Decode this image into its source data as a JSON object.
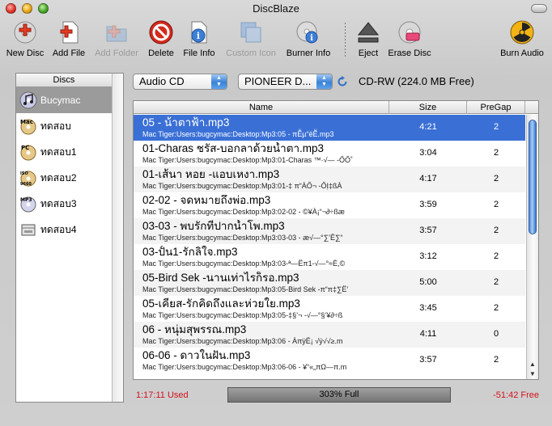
{
  "window": {
    "title": "DiscBlaze"
  },
  "toolbar": [
    {
      "label": "New Disc",
      "icon": "new-disc-icon",
      "enabled": true
    },
    {
      "label": "Add File",
      "icon": "add-file-icon",
      "enabled": true
    },
    {
      "label": "Add Folder",
      "icon": "add-folder-icon",
      "enabled": false
    },
    {
      "label": "Delete",
      "icon": "delete-icon",
      "enabled": true
    },
    {
      "label": "File Info",
      "icon": "file-info-icon",
      "enabled": true
    },
    {
      "label": "Custom Icon",
      "icon": "custom-icon-icon",
      "enabled": false
    },
    {
      "label": "Burner Info",
      "icon": "burner-info-icon",
      "enabled": true
    },
    {
      "label": "Eject",
      "icon": "eject-icon",
      "enabled": true
    },
    {
      "label": "Erase Disc",
      "icon": "erase-disc-icon",
      "enabled": true
    },
    {
      "label": "Burn Audio",
      "icon": "burn-audio-icon",
      "enabled": true
    }
  ],
  "sidebar": {
    "header": "Discs",
    "items": [
      {
        "label": "Bucymac",
        "icon": "music-disc-icon",
        "selected": true
      },
      {
        "label": "ทดสอบ",
        "icon": "mac-disc-icon",
        "badge": "Mac"
      },
      {
        "label": "ทดสอบ1",
        "icon": "pc-disc-icon",
        "badge": "PC"
      },
      {
        "label": "ทดสอบ2",
        "icon": "iso-disc-icon",
        "badge": "ISO 9660"
      },
      {
        "label": "ทดสอบ3",
        "icon": "mp3-disc-icon",
        "badge": "MP3"
      },
      {
        "label": "ทดสอบ4",
        "icon": "drive-icon"
      }
    ]
  },
  "controls": {
    "disc_type": "Audio CD",
    "burner": "PIONEER D...",
    "disc_info": "CD-RW (224.0 MB Free)"
  },
  "table": {
    "columns": [
      "Name",
      "Size",
      "PreGap"
    ],
    "rows": [
      {
        "title": "05 - น้าตาฟ้า.mp3",
        "path": "Mac Tiger:Users:bugcymac:Desktop:Mp3:05 - πẼ̈µ“ëẼ̈.mp3",
        "size": "4:21",
        "pregap": "2",
        "selected": true
      },
      {
        "title": "01-Charas ชรัส-บอกลาด้วยน้ำตา.mp3",
        "path": "Mac Tiger:Users:bugcymac:Desktop:Mp3:01-Charas ™·√— -ŐŐ˚",
        "size": "3:04",
        "pregap": "2"
      },
      {
        "title": "01-เส้นา หอย -แอบเหงา.mp3",
        "path": "Mac Tiger:Users:bugcymac:Desktop:Mp3:01-‡ π“ÀŐ¬ -ŐỊ‡ßÀ",
        "size": "4:17",
        "pregap": "2"
      },
      {
        "title": "02-02 - จดหมายถึงพ่อ.mp3",
        "path": "Mac Tiger:Users:bugcymac:Desktop:Mp3:02-02 - ©¥À¡“¬∂÷ßæ",
        "size": "3:59",
        "pregap": "2"
      },
      {
        "title": "03-03 - พบรักที่ปากน้ำโพ.mp3",
        "path": "Mac Tiger:Users:bugcymac:Desktop:Mp3:03-03 - æ√—°∑’Ë∑“",
        "size": "3:57",
        "pregap": "2"
      },
      {
        "title": "03-ปั้น1-รักลิใจ.mp3",
        "path": "Mac Tiger:Users:bugcymac:Desktop:Mp3:03-ª—Ëπ1-√—°≈È,©",
        "size": "3:12",
        "pregap": "2"
      },
      {
        "title": "05-Bird Sek -นานเท่าไรก็รอ.mp3",
        "path": "Mac Tiger:Users:bugcymac:Desktop:Mp3:05-Bird Sek -π“π‡∑Ë’",
        "size": "5:00",
        "pregap": "2"
      },
      {
        "title": "05-เคียส-รักคิดถึงและห่วยใย.mp3",
        "path": "Mac Tiger:Users:bugcymac:Desktop:Mp3:05-‡§’¬ -√—°§‘¥∂÷ß",
        "size": "3:45",
        "pregap": "2"
      },
      {
        "title": "06 - หนุ่มสุพรรณ.mp3",
        "path": "Mac Tiger:Users:bugcymac:Desktop:Mp3:06 - ÀπÿË¡ √ÿ√√≥.m",
        "size": "4:11",
        "pregap": "0"
      },
      {
        "title": "06-06 - ดาวในฝัน.mp3",
        "path": "Mac Tiger:Users:bugcymac:Desktop:Mp3:06-06 - ¥“«„πΩ—π.m",
        "size": "3:57",
        "pregap": "2"
      }
    ]
  },
  "footer": {
    "used": "1:17:11 Used",
    "progress_label": "303% Full",
    "free": "-51:42 Free",
    "progress_fraction": 1.0
  },
  "colors": {
    "selection": "#3a70d6",
    "used_text": "#d0121b",
    "free_text": "#d0121b",
    "scroll_thumb": "#4c86d6"
  }
}
